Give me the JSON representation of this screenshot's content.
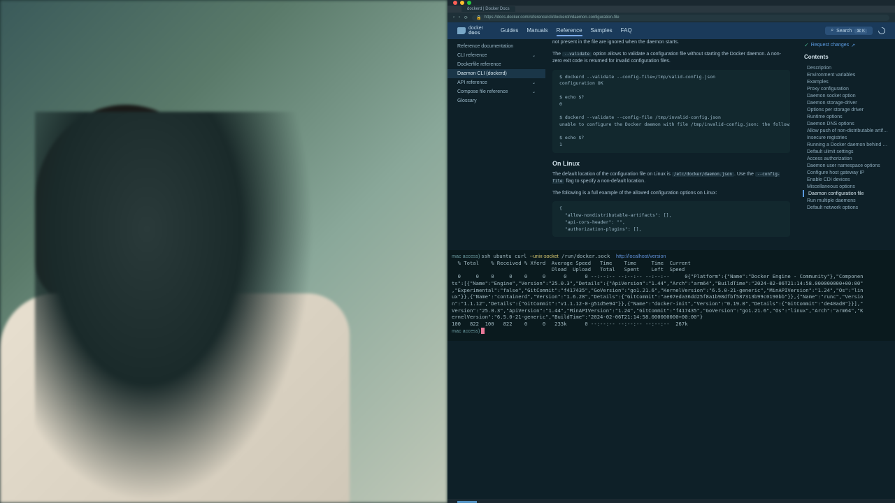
{
  "browser": {
    "tab_title": "dockerd | Docker Docs",
    "url": "https://docs.docker.com/reference/cli/dockerd/#daemon-configuration-file"
  },
  "header": {
    "logo_top": "docker",
    "logo_bottom": "docs",
    "nav": [
      "Guides",
      "Manuals",
      "Reference",
      "Samples",
      "FAQ"
    ],
    "active_nav": "Reference",
    "search_label": "Search",
    "kbd_shortcut": "⌘ K"
  },
  "sidebar": {
    "items": [
      {
        "label": "Reference documentation",
        "expandable": false
      },
      {
        "label": "CLI reference",
        "expandable": true
      },
      {
        "label": "Dockerfile reference",
        "expandable": false
      },
      {
        "label": "Daemon CLI (dockerd)",
        "expandable": false,
        "selected": true
      },
      {
        "label": "API reference",
        "expandable": true
      },
      {
        "label": "Compose file reference",
        "expandable": true
      },
      {
        "label": "Glossary",
        "expandable": false
      }
    ]
  },
  "content": {
    "p1_a": "not present in the file are ignored when the daemon starts.",
    "p2_a": "The ",
    "p2_code": "--validate",
    "p2_b": " option allows to validate a configuration file without starting the Docker daemon. A non-zero exit code is returned for invalid configuration files.",
    "code1": "$ dockerd --validate --config-file=/tmp/valid-config.json\nconfiguration OK\n\n$ echo $?\n0\n\n$ dockerd --validate --config-file /tmp/invalid-config.json\nunable to configure the Docker daemon with file /tmp/invalid-config.json: the following direc\n\n$ echo $?\n1",
    "h3": "On Linux",
    "p3_a": "The default location of the configuration file on Linux is ",
    "p3_code1": "/etc/docker/daemon.json",
    "p3_b": ". Use the ",
    "p3_code2": "--config-file",
    "p3_c": " flag to specify a non-default location.",
    "p4": "The following is a full example of the allowed configuration options on Linux:",
    "code2": "{\n  \"allow-nondistributable-artifacts\": [],\n  \"api-cors-header\": \"\",\n  \"authorization-plugins\": [],"
  },
  "toc": {
    "request_changes": "Request changes",
    "title": "Contents",
    "items": [
      "Description",
      "Environment variables",
      "Examples",
      "Proxy configuration",
      "Daemon socket option",
      "Daemon storage-driver",
      "Options per storage driver",
      "Runtime options",
      "Daemon DNS options",
      "Allow push of non-distributable artifacts",
      "Insecure registries",
      "Running a Docker daemon behind an HTTPS_PROXY",
      "Default ulimit settings",
      "Access authorization",
      "Daemon user namespace options",
      "Configure host gateway IP",
      "Enable CDI devices",
      "Miscellaneous options",
      "Daemon configuration file",
      "Run multiple daemons",
      "Default network options"
    ],
    "active": "Daemon configuration file"
  },
  "terminal": {
    "line1_prompt": "mac access) ",
    "line1_cmd": "ssh ubuntu curl ",
    "line1_flag": "--unix-socket",
    "line1_path": " /run/docker.sock  ",
    "line1_url": "http://localhost/version",
    "headers1": "  % Total    % Received % Xferd  Average Speed   Time    Time     Time  Current",
    "headers2": "                                 Dload  Upload   Total   Spent    Left  Speed",
    "progress1": "  0     0    0     0    0     0      0      0 --:--:-- --:--:-- --:--:--     0{\"Platform\":{\"Name\":\"Docker Engine - Community\"},\"Componen",
    "json1": "ts\":[{\"Name\":\"Engine\",\"Version\":\"25.0.3\",\"Details\":{\"ApiVersion\":\"1.44\",\"Arch\":\"arm64\",\"BuildTime\":\"2024-02-06T21:14:58.000000000+00:00\"",
    "json2": ",\"Experimental\":\"false\",\"GitCommit\":\"f417435\",\"GoVersion\":\"go1.21.6\",\"KernelVersion\":\"6.5.0-21-generic\",\"MinAPIVersion\":\"1.24\",\"Os\":\"lin",
    "json3": "ux\"}},{\"Name\":\"containerd\",\"Version\":\"1.6.28\",\"Details\":{\"GitCommit\":\"ae07eda36dd25f8a1b98dfbf587313b99c0190bb\"}},{\"Name\":\"runc\",\"Versio",
    "json4": "n\":\"1.1.12\",\"Details\":{\"GitCommit\":\"v1.1.12-0-g51d5e94\"}},{\"Name\":\"docker-init\",\"Version\":\"0.19.0\",\"Details\":{\"GitCommit\":\"de40ad0\"}}],\"",
    "json5": "Version\":\"25.0.3\",\"ApiVersion\":\"1.44\",\"MinAPIVersion\":\"1.24\",\"GitCommit\":\"f417435\",\"GoVersion\":\"go1.21.6\",\"Os\":\"linux\",\"Arch\":\"arm64\",\"K",
    "json6": "ernelVersion\":\"6.5.0-21-generic\",\"BuildTime\":\"2024-02-06T21:14:58.000000000+00:00\"}",
    "progress2": "100   822  100   822    0     0   233k      0 --:--:-- --:--:-- --:--:--  267k",
    "line_last_prompt": "mac access) "
  }
}
